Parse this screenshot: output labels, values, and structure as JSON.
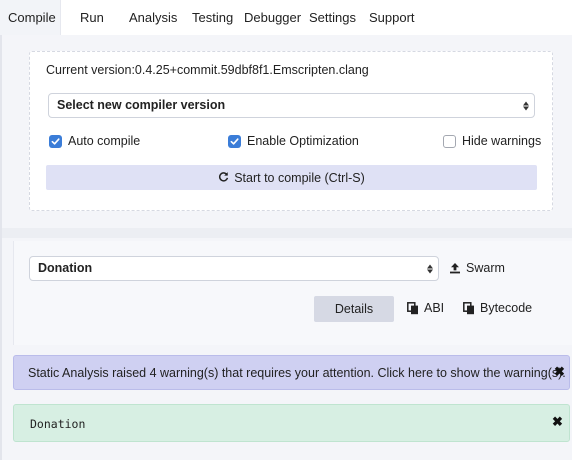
{
  "tabs": [
    {
      "label": "Compile",
      "active": true
    },
    {
      "label": "Run"
    },
    {
      "label": "Analysis"
    },
    {
      "label": "Testing"
    },
    {
      "label": "Debugger"
    },
    {
      "label": "Settings"
    },
    {
      "label": "Support"
    }
  ],
  "compiler": {
    "current_version": "Current version:0.4.25+commit.59dbf8f1.Emscripten.clang",
    "select_label": "Select new compiler version",
    "auto_compile_label": "Auto compile",
    "auto_compile_checked": true,
    "optimization_label": "Enable Optimization",
    "optimization_checked": true,
    "hide_warnings_label": "Hide warnings",
    "hide_warnings_checked": false,
    "compile_button_label": "Start to compile (Ctrl-S)"
  },
  "contract": {
    "selected": "Donation",
    "swarm_label": "Swarm",
    "details_label": "Details",
    "abi_label": "ABI",
    "bytecode_label": "Bytecode"
  },
  "alerts": {
    "warning_message": "Static Analysis raised 4 warning(s) that requires your attention. Click here to show the warning(s).",
    "success_contract": "Donation",
    "close_symbol": "✖"
  },
  "colors": {
    "accent_checkbox": "#3b7dd8",
    "compile_button_bg": "#dfe1f5",
    "warning_bg": "#cfd0f2",
    "success_bg": "#d7efe3"
  }
}
